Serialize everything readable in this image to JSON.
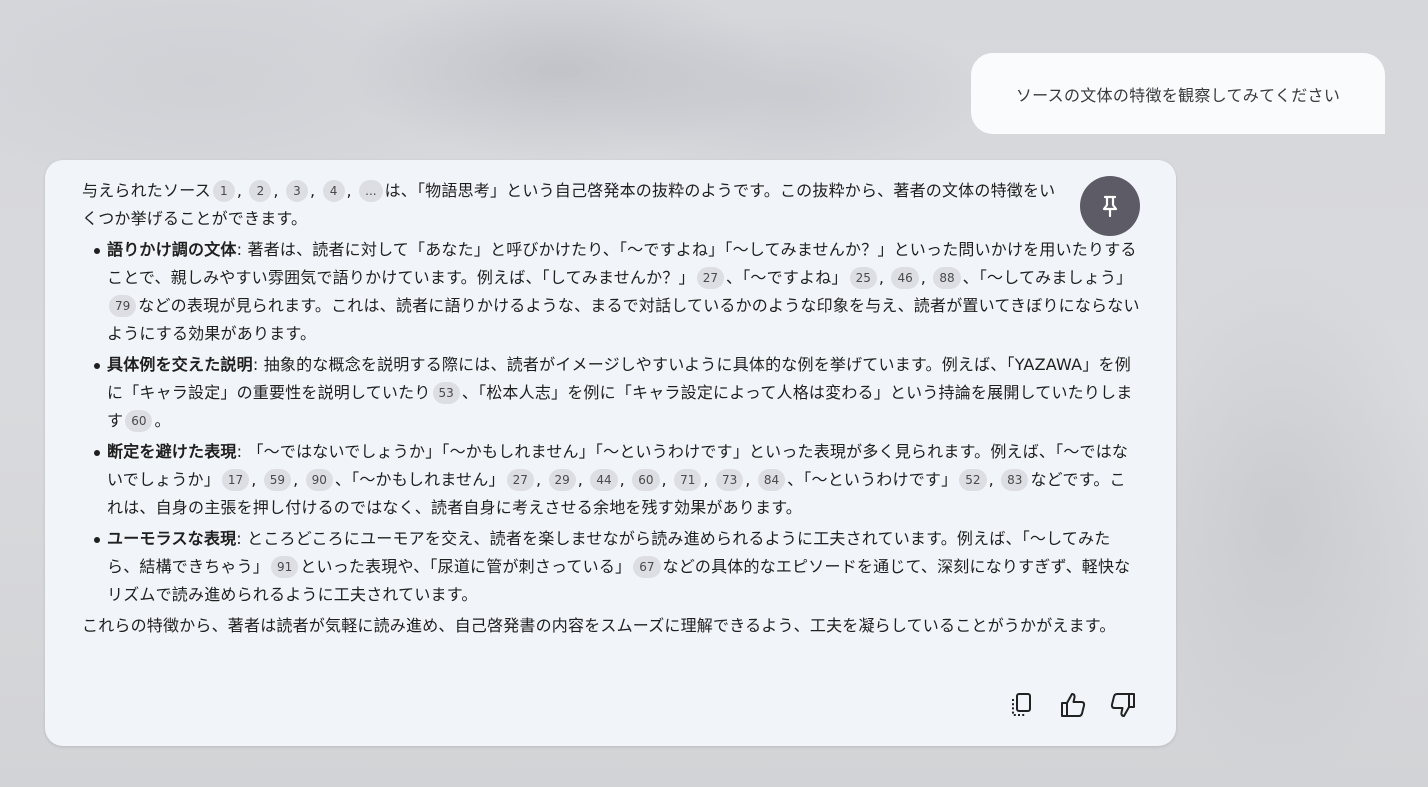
{
  "user_message": {
    "text": "ソースの文体の特徴を観察してみてください"
  },
  "response": {
    "intro": {
      "before": "与えられたソース",
      "citations": [
        "1",
        "2",
        "3",
        "4",
        "..."
      ],
      "after": "は、「物語思考」という自己啓発本の抜粋のようです。この抜粋から、著者の文体の特徴をいくつか挙げることができます。"
    },
    "bullets": [
      {
        "title": "語りかけ調の文体",
        "t1": ": 著者は、読者に対して「あなた」と呼びかけたり、「〜ですよね」「〜してみませんか？」といった問いかけを用いたりすることで、親しみやすい雰囲気で語りかけています。例えば、「してみませんか？」",
        "c1": [
          "27"
        ],
        "t2": "、「〜ですよね」",
        "c2": [
          "25",
          "46",
          "88"
        ],
        "t3": "、「〜してみましょう」",
        "c3": [
          "79"
        ],
        "t4": "などの表現が見られます。これは、読者に語りかけるような、まるで対話しているかのような印象を与え、読者が置いてきぼりにならないようにする効果があります。"
      },
      {
        "title": "具体例を交えた説明",
        "t1": ": 抽象的な概念を説明する際には、読者がイメージしやすいように具体的な例を挙げています。例えば、「YAZAWA」を例に「キャラ設定」の重要性を説明していたり",
        "c1": [
          "53"
        ],
        "t2": "、「松本人志」を例に「キャラ設定によって人格は変わる」という持論を展開していたりします",
        "c2": [
          "60"
        ],
        "t3": "。"
      },
      {
        "title": "断定を避けた表現",
        "t1": ": 「〜ではないでしょうか」「〜かもしれません」「〜というわけです」といった表現が多く見られます。例えば、「〜ではないでしょうか」",
        "c1": [
          "17",
          "59",
          "90"
        ],
        "t2": "、「〜かもしれません」",
        "c2": [
          "27",
          "29",
          "44",
          "60",
          "71",
          "73",
          "84"
        ],
        "t3": "、「〜というわけです」",
        "c3": [
          "52",
          "83"
        ],
        "t4": "などです。これは、自身の主張を押し付けるのではなく、読者自身に考えさせる余地を残す効果があります。"
      },
      {
        "title": "ユーモラスな表現",
        "t1": ": ところどころにユーモアを交え、読者を楽しませながら読み進められるように工夫されています。例えば、「〜してみたら、結構できちゃう」",
        "c1": [
          "91"
        ],
        "t2": "といった表現や、「尿道に管が刺さっている」",
        "c2": [
          "67"
        ],
        "t3": "などの具体的なエピソードを通じて、深刻になりすぎず、軽快なリズムで読み進められるように工夫されています。"
      }
    ],
    "conclusion": "これらの特徴から、著者は読者が気軽に読み進め、自己啓発書の内容をスムーズに理解できるよう、工夫を凝らしていることがうかがえます。"
  },
  "icons": {
    "pin": "pin-icon",
    "copy": "copy-icon",
    "like": "thumbs-up-icon",
    "dislike": "thumbs-down-icon"
  },
  "colors": {
    "card_background": "#f1f4f8",
    "pin_button": "#5d5b66",
    "citation_chip": "#dcdee3"
  }
}
